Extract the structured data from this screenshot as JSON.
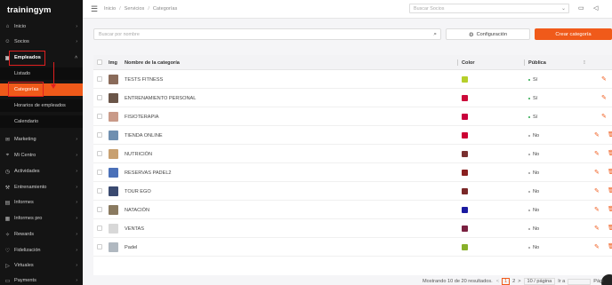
{
  "sidebar": {
    "logo": "trainingym",
    "items": [
      {
        "label": "Inicio",
        "icon": "home-icon",
        "glyph": "⌂"
      },
      {
        "label": "Socios",
        "icon": "users-icon",
        "glyph": "☺"
      },
      {
        "label": "Empleados",
        "icon": "employee-icon",
        "glyph": "▣"
      }
    ],
    "sub_items": [
      {
        "label": "Listado"
      },
      {
        "label": "Categorías"
      },
      {
        "label": "Horarios de empleados"
      },
      {
        "label": "Calendario"
      }
    ],
    "items2": [
      {
        "label": "Marketing",
        "icon": "marketing-icon",
        "glyph": "✉"
      },
      {
        "label": "Mi Centro",
        "icon": "location-icon",
        "glyph": "⌖"
      },
      {
        "label": "Actividades",
        "icon": "activities-icon",
        "glyph": "◷"
      },
      {
        "label": "Entrenamiento",
        "icon": "training-icon",
        "glyph": "⚒"
      },
      {
        "label": "Informes",
        "icon": "reports-icon",
        "glyph": "▤"
      },
      {
        "label": "Informes pro",
        "icon": "reports-pro-icon",
        "glyph": "▦"
      },
      {
        "label": "Rewards",
        "icon": "rewards-icon",
        "glyph": "✧"
      },
      {
        "label": "Fidelización",
        "icon": "loyalty-icon",
        "glyph": "♡"
      },
      {
        "label": "Virtuales",
        "icon": "virtual-icon",
        "glyph": "▷"
      },
      {
        "label": "Payments",
        "icon": "payments-icon",
        "glyph": "▭"
      }
    ]
  },
  "topbar": {
    "breadcrumb": [
      "Inicio",
      "Servicios",
      "Categorías"
    ],
    "search_placeholder": "Buscar Socios"
  },
  "toolbar": {
    "search_placeholder": "Buscar por nombre",
    "config_label": "Configuración",
    "create_label": "Crear categoría"
  },
  "table": {
    "headers": {
      "img": "Img",
      "name": "Nombre de la categoría",
      "color": "Color",
      "public": "Pública"
    },
    "rows": [
      {
        "name": "TESTS FITNESS",
        "color": "#b6cf2a",
        "public": "Sí",
        "thumb": "#8a6b5a"
      },
      {
        "name": "ENTRENAMIENTO PERSONAL",
        "color": "#cc0a3a",
        "public": "Sí",
        "thumb": "#6a5548"
      },
      {
        "name": "FISIOTERAPIA",
        "color": "#c8003c",
        "public": "Sí",
        "thumb": "#c99a88"
      },
      {
        "name": "TIENDA ONLINE",
        "color": "#cc0033",
        "public": "No",
        "thumb": "#6f8fb0"
      },
      {
        "name": "NUTRICIÓN",
        "color": "#7a3030",
        "public": "No",
        "thumb": "#c8a070"
      },
      {
        "name": "RESERVAS PADEL2",
        "color": "#8a2020",
        "public": "No",
        "thumb": "#4a70b8"
      },
      {
        "name": "TOUR EGO",
        "color": "#7a2828",
        "public": "No",
        "thumb": "#3a4a70"
      },
      {
        "name": "NATACIÓN",
        "color": "#1a1aa0",
        "public": "No",
        "thumb": "#8a7a60"
      },
      {
        "name": "VENTAS",
        "color": "#7a2040",
        "public": "No",
        "thumb": "#d8d8d8"
      },
      {
        "name": "Padel",
        "color": "#88b02a",
        "public": "No",
        "thumb": "#b0b8c0"
      }
    ]
  },
  "pagination": {
    "summary": "Mostrando 10 de 20 resultados.",
    "prev": "<",
    "pages": [
      "1",
      "2"
    ],
    "next": ">",
    "page_size": "10 / página",
    "goto_label": "Ir a",
    "page_label": "Pági"
  },
  "colors": {
    "accent": "#f05a1a",
    "sidebar_bg": "#141414",
    "highlight": "#e02020"
  }
}
